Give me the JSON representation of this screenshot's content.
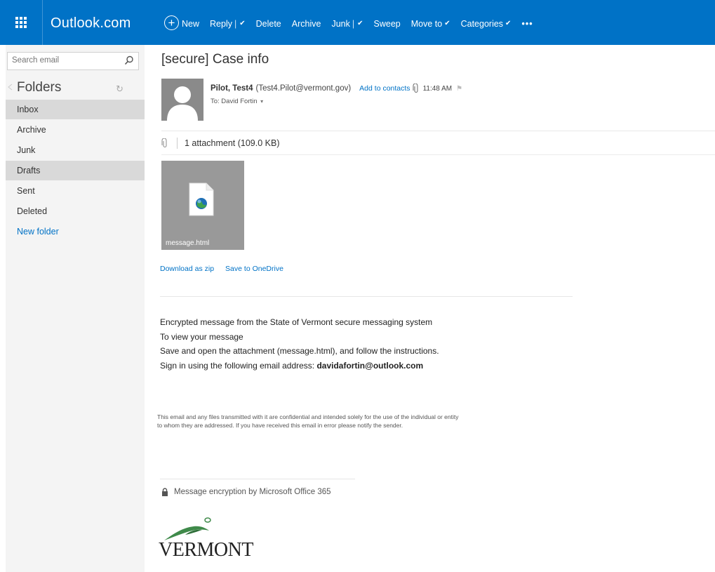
{
  "topbar": {
    "brand": "Outlook.com",
    "commands": {
      "new": "New",
      "reply": "Reply",
      "delete": "Delete",
      "archive": "Archive",
      "junk": "Junk",
      "sweep": "Sweep",
      "move_to": "Move to",
      "categories": "Categories",
      "more": "•••"
    },
    "color": "#0072c6"
  },
  "sidebar": {
    "search_placeholder": "Search email",
    "folders_title": "Folders",
    "refresh_glyph": "↻",
    "items": [
      {
        "label": "Inbox",
        "selected": true
      },
      {
        "label": "Archive",
        "selected": false
      },
      {
        "label": "Junk",
        "selected": false
      },
      {
        "label": "Drafts",
        "selected": true
      },
      {
        "label": "Sent",
        "selected": false
      },
      {
        "label": "Deleted",
        "selected": false
      }
    ],
    "new_folder": "New folder"
  },
  "message": {
    "subject": "[secure] Case info",
    "sender_name": "Pilot, Test4",
    "sender_email": "(Test4.Pilot@vermont.gov)",
    "add_to_contacts": "Add to contacts",
    "time": "11:48 AM",
    "to": "To: David Fortin",
    "attachment_summary": "1 attachment (109.0 KB)",
    "attachment_name": "message.html",
    "download_zip": "Download as zip",
    "save_onedrive": "Save to OneDrive",
    "body": {
      "line1": "Encrypted message from the State of Vermont secure messaging system",
      "line2": "To view your message",
      "line3": "Save and open the attachment (message.html), and follow the instructions.",
      "line4_prefix": "Sign in using the following email address: ",
      "line4_email": "davidafortin@outlook.com"
    },
    "disclaimer_line1": "This email and any files transmitted with it are confidential and intended solely for the use of the individual or entity",
    "disclaimer_line2": "to whom they are addressed. If you have received this email in error please notify the sender.",
    "encryption_note": "Message encryption by Microsoft Office 365",
    "logo_text": "VERMONT"
  }
}
